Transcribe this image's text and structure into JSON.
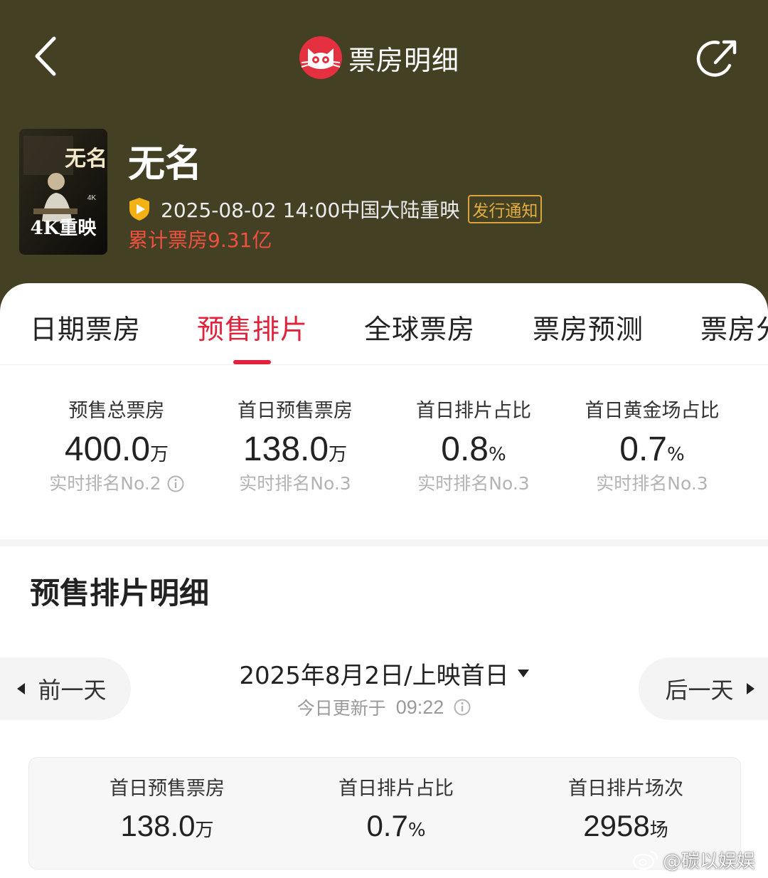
{
  "colors": {
    "header_bg": "#434024",
    "accent_red": "#e0223b",
    "box_office_red": "#f0503f",
    "badge_gold": "#e2ae43"
  },
  "nav": {
    "title": "票房明细",
    "back_icon": "chevron-left-icon",
    "share_icon": "share-icon",
    "logo_icon": "maoyan-cat-logo"
  },
  "movie": {
    "title": "无名",
    "poster_text": "4K重映",
    "poster_title": "无名",
    "poster_badge": "4K",
    "release": "2025-08-02 14:00中国大陆重映",
    "notice_badge": "发行通知",
    "cumulative": "累计票房9.31亿"
  },
  "tabs": [
    {
      "label": "日期票房",
      "active": false
    },
    {
      "label": "预售排片",
      "active": true
    },
    {
      "label": "全球票房",
      "active": false
    },
    {
      "label": "票房预测",
      "active": false
    },
    {
      "label": "票房分",
      "active": false
    }
  ],
  "stats": [
    {
      "label": "预售总票房",
      "value": "400.0",
      "unit": "万",
      "rank": "实时排名No.2"
    },
    {
      "label": "首日预售票房",
      "value": "138.0",
      "unit": "万",
      "rank": "实时排名No.3"
    },
    {
      "label": "首日排片占比",
      "value": "0.8",
      "unit": "%",
      "rank": "实时排名No.3"
    },
    {
      "label": "首日黄金场占比",
      "value": "0.7",
      "unit": "%",
      "rank": "实时排名No.3"
    }
  ],
  "detail": {
    "title": "预售排片明细",
    "prev_label": "前一天",
    "next_label": "后一天",
    "date_label": "2025年8月2日/上映首日",
    "update_label": "今日更新于",
    "update_time": "09:22"
  },
  "summary": [
    {
      "label": "首日预售票房",
      "value": "138.0",
      "unit": "万"
    },
    {
      "label": "首日排片占比",
      "value": "0.7",
      "unit": "%"
    },
    {
      "label": "首日排片场次",
      "value": "2958",
      "unit": "场"
    }
  ],
  "watermark": {
    "text": "@碳以娱娱",
    "icon": "weibo-icon"
  }
}
